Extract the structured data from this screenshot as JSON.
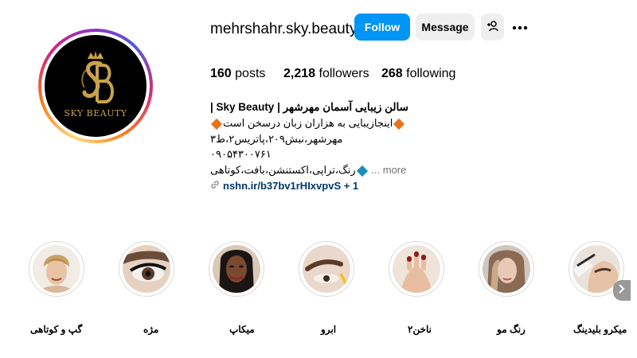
{
  "profile": {
    "username": "mehrshahr.sky.beauty",
    "follow_label": "Follow",
    "message_label": "Message",
    "logo_text": "SKY BEAUTY",
    "logo_monogram": "SB"
  },
  "stats": {
    "posts_count": "160",
    "posts_label": "posts",
    "followers_count": "2,218",
    "followers_label": "followers",
    "following_count": "268",
    "following_label": "following"
  },
  "bio": {
    "name": "سالن زیبایی آسمان مهرشهر | Sky Beauty |",
    "line1": "اینجازیبایی به هزاران زبان درسخن است",
    "line2": "مهرشهر،نبش۲۰۹،پاتریس۲،ط۳",
    "line3": "۰۹۰۵۴۳۰۰۷۶۱",
    "line4": "رنگ،تراپی،اکستنشن،بافت،کوتاهی",
    "more_label": "... more",
    "link_text": "nshn.ir/b37bv1rHIxvpvS + 1"
  },
  "highlights": [
    {
      "label": "گپ و کوتاهی"
    },
    {
      "label": "مژه"
    },
    {
      "label": "میکاپ"
    },
    {
      "label": "ابرو"
    },
    {
      "label": "ناخن۲"
    },
    {
      "label": "رنگ مو"
    },
    {
      "label": "میکرو بلیدینگ"
    }
  ],
  "colors": {
    "follow_blue": "#0095f6",
    "secondary_button": "#efefef",
    "link_color": "#00376b",
    "logo_gold": "#c9a24a"
  },
  "icons": [
    "add-user-icon",
    "more-options-icon",
    "link-icon",
    "chevron-right-icon",
    "orange-diamond-icon",
    "blue-diamond-icon"
  ]
}
